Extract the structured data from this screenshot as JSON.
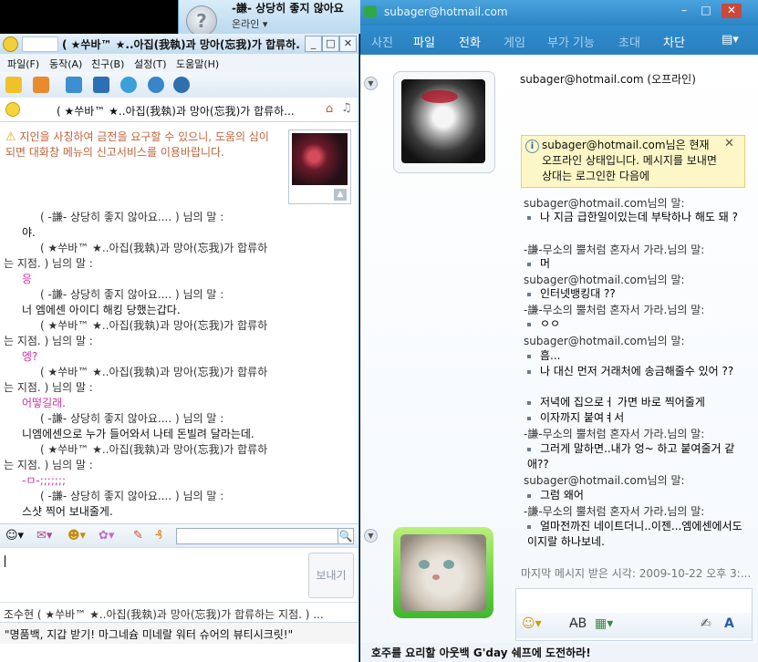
{
  "background": {
    "messenger_nick": "-謙- 상당히 좋지 않아요",
    "messenger_status": "온라인 ▾"
  },
  "nate": {
    "title": "( ★쑤바™ ★..아집(我執)과 망아(忘我)가 합류하...",
    "menu": [
      "파일(F)",
      "동작(A)",
      "친구(B)",
      "설정(T)",
      "도움말(H)"
    ],
    "sub_title": "( ★쑤바™ ★..아집(我執)과 망아(忘我)가 합류하...",
    "warning": "지인을 사칭하여 금전을 요구할 수 있으니, 도움의 심이 되면 대화창 메뉴의 신고서비스를 이용바랍니다.",
    "chat": [
      {
        "who": "( -謙- 상당히 좋지 않아요.... ) 님의 말 :",
        "msg": "야.",
        "pink": false
      },
      {
        "who": "( ★쑤바™ ★..아집(我執)과 망아(忘我)가 합류하는 지점. ) 님의 말 :",
        "msg": "응",
        "pink": true
      },
      {
        "who": "( -謙- 상당히 좋지 않아요.... ) 님의 말 :",
        "msg": "너 엠에센 아이디 해킹 당했는갑다.",
        "pink": false
      },
      {
        "who": "( ★쑤바™ ★..아집(我執)과 망아(忘我)가 합류하는 지점. ) 님의 말 :",
        "msg": "엥?",
        "pink": true
      },
      {
        "who": "( ★쑤바™ ★..아집(我執)과 망아(忘我)가 합류하는 지점. ) 님의 말 :",
        "msg": "어떻길래.",
        "pink": true
      },
      {
        "who": "( -謙- 상당히 좋지 않아요.... ) 님의 말 :",
        "msg": "니엠에센으로 누가 들어와서 나테 돈빌려 달라는데.",
        "pink": false
      },
      {
        "who": "( ★쑤바™ ★..아집(我執)과 망아(忘我)가 합류하는 지점. ) 님의 말 :",
        "msg": "-ㅁ-;;;;;;;",
        "pink": true
      },
      {
        "who": "( -謙- 상당히 좋지 않아요.... ) 님의 말 :",
        "msg": "스샷 찍어 보내줄게.",
        "pink": false
      }
    ],
    "send_label": "보내기",
    "status_line": "조수현 ( ★쑤바™ ★..아집(我執)과 망아(忘我)가 합류하는 지점. ) ...",
    "ad": "\"명품백, 지갑 받기! 마그네슘 미네랄 워터 슈어의 뷰티시크릿!\""
  },
  "msn": {
    "title": "subager@hotmail.com",
    "menu": [
      "사진",
      "파일",
      "전화",
      "게임",
      "부가 기능",
      "초대",
      "차단"
    ],
    "header": "subager@hotmail.com (오프라인)",
    "offline_notice": "subager@hotmail.com님은 현재 오프라인 상태입니다. 메시지를 보내면 상대는 로그인한 다음에",
    "messages": [
      {
        "who": "subager@hotmail.com님의 말:",
        "lines": [
          "나 지금 급한일이있는데 부탁하나 해도 돼 ?"
        ]
      },
      {
        "who": "-謙-무소의 뿔처럼 혼자서 가라.님의 말:",
        "lines": [
          "머"
        ]
      },
      {
        "who": "subager@hotmail.com님의 말:",
        "lines": [
          "인터넷뱅킹대 ??"
        ]
      },
      {
        "who": "-謙-무소의 뿔처럼 혼자서 가라.님의 말:",
        "lines": [
          "ㅇㅇ"
        ]
      },
      {
        "who": "subager@hotmail.com님의 말:",
        "lines": [
          "흠...",
          "나 대신 먼저 거래처에 송금해줄수 있어 ??",
          "저녁에 집으로ㅓ 가면 바로 찍어줄게",
          "이자까지 붙여ㅕ서"
        ]
      },
      {
        "who": "-謙-무소의 뿔처럼 혼자서 가라.님의 말:",
        "lines": [
          "그러게 말하면..내가 엉~ 하고 붙여줄거 같애??"
        ]
      },
      {
        "who": "subager@hotmail.com님의 말:",
        "lines": [
          "그럼 왜어"
        ]
      },
      {
        "who": "-謙-무소의 뿔처럼 혼자서 가라.님의 말:",
        "lines": [
          "얼마전까진 네이트더니..이젠...엠에센에서도 이지랄 하나보네."
        ]
      }
    ],
    "last_received": "마지막 메시지 받은 시각: 2009-10-22 오후 3:...",
    "ad": "호주를 요리할 아웃백 G'day 쉐프에 도전하라!"
  }
}
